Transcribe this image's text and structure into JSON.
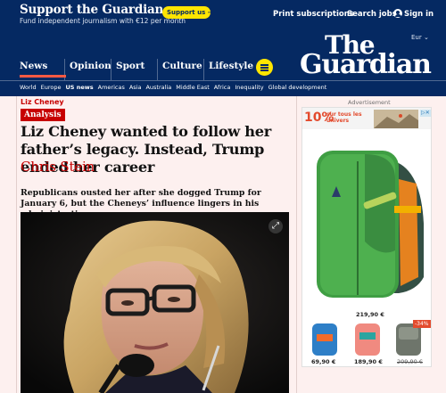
{
  "support": {
    "title": "Support the Guardian",
    "subtitle": "Fund independent journalism with €12 per month",
    "button": "Support us →"
  },
  "top_links": {
    "print": "Print subscriptions",
    "jobs": "Search jobs",
    "signin": "Sign in"
  },
  "edition": "Eur ⌄",
  "logo": {
    "line1": "The",
    "line2": "Guardian"
  },
  "pillars": [
    "News",
    "Opinion",
    "Sport",
    "Culture",
    "Lifestyle"
  ],
  "subnav": [
    "World",
    "Europe",
    "US news",
    "Americas",
    "Asia",
    "Australia",
    "Middle East",
    "Africa",
    "Inequality",
    "Global development"
  ],
  "article": {
    "kicker": "Liz Cheney",
    "label": "Analysis",
    "headline": "Liz Cheney wanted to follow her father’s legacy. Instead, Trump ended her career",
    "byline": "Chris Stein",
    "standfirst": "Republicans ousted her after she dogged Trump for January 6, but the Cheneys’ influence lingers in his administration",
    "expand_icon_symbol": "⤢"
  },
  "ad": {
    "label": "Advertisement",
    "percent": "10%",
    "promo": "sur tous les univers",
    "adchoice": "▷✕",
    "main_price": "219,90 €",
    "prices": [
      "69,90 €",
      "189,90 €",
      "209,90 €"
    ],
    "discount": "-34%"
  },
  "colors": {
    "brand_blue": "#052962",
    "accent_red": "#c70000",
    "support_yellow": "#ffe500",
    "news_underline": "#ff5943"
  }
}
